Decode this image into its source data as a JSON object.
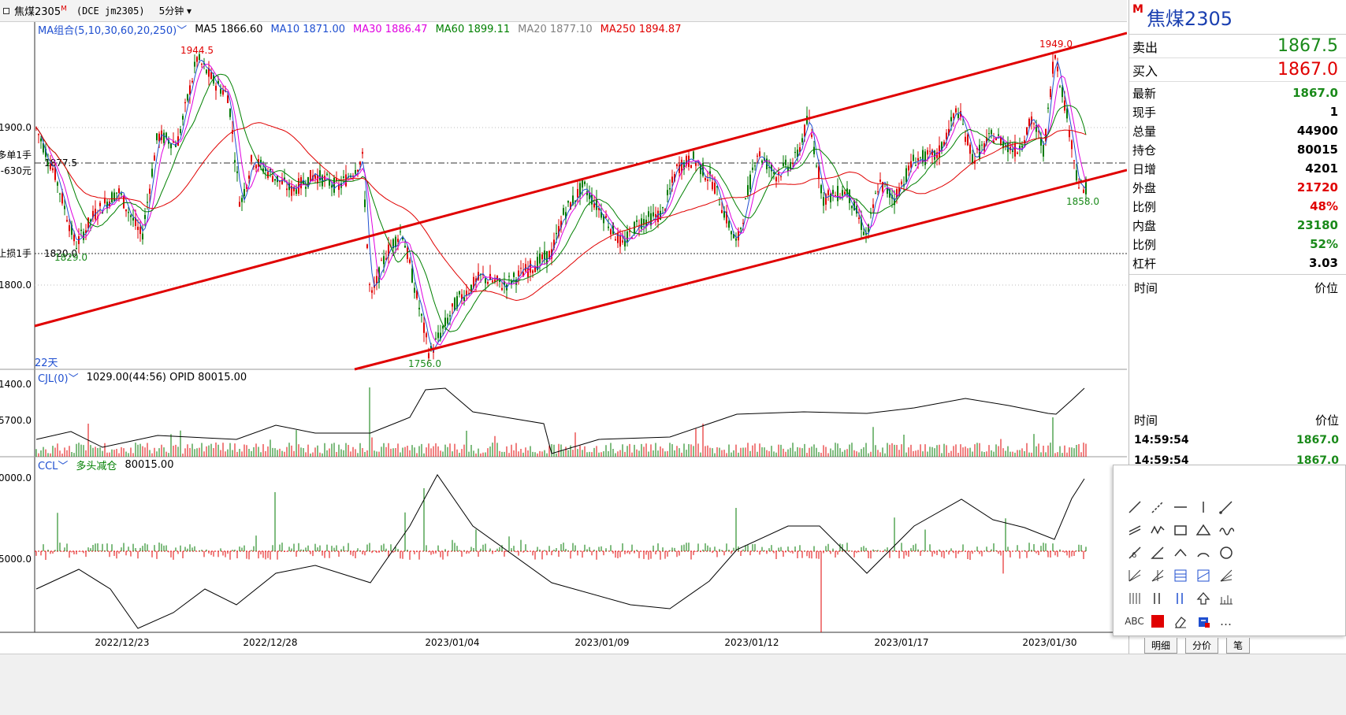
{
  "window": {
    "symbol": "焦煤2305",
    "symbol_marker": "M",
    "code": "(DCE  jm2305)",
    "period": "5分钟"
  },
  "colors": {
    "up": "#e00000",
    "down": "#007a00",
    "ma5": "#000000",
    "ma10": "#1f4fd0",
    "ma30": "#e000e0",
    "ma60": "#008000",
    "ma20": "#808080",
    "ma250": "#e00000",
    "channel": "#e00000",
    "price_down": "#1a8a1a",
    "price_up": "#e00000"
  },
  "indicators": {
    "ma_group": "MA组合(5,10,30,60,20,250)",
    "ma5": "MA5  1866.60",
    "ma10": "MA10  1871.00",
    "ma30": "MA30  1886.47",
    "ma60": "MA60  1899.11",
    "ma20": "MA20  1877.10",
    "ma250": "MA250  1894.87"
  },
  "price_pane": {
    "y_labels": [
      "1900.0",
      "1800.0"
    ],
    "lines": {
      "open_label": "多单1手",
      "open_price": "1877.5",
      "pnl": "-630元",
      "stop_label": "止损1手",
      "stop_price": "1820.0"
    },
    "annotations": {
      "high1": "1944.5",
      "low1": "1829.0",
      "low2": "1756.0",
      "high2": "1949.0",
      "last": "1858.0"
    },
    "days": "22天"
  },
  "vol_pane": {
    "title": "CJL(0)",
    "value": "1029.00(44:56)  OPID 80015.00",
    "y_labels": [
      "1400.0",
      "5700.0"
    ]
  },
  "ccl_pane": {
    "title": "CCL",
    "label": "多头减仓",
    "value": "80015.00",
    "y_labels": [
      "0000.0",
      "5000.0"
    ]
  },
  "x_axis": [
    "2022/12/23",
    "2022/12/28",
    "2023/01/04",
    "2023/01/09",
    "2023/01/12",
    "2023/01/17",
    "2023/01/30"
  ],
  "quote": {
    "sell_label": "卖出",
    "sell_value": "1867.5",
    "buy_label": "买入",
    "buy_value": "1867.0",
    "rows": [
      {
        "label": "最新",
        "value": "1867.0",
        "color": "#1a8a1a"
      },
      {
        "label": "现手",
        "value": "1",
        "color": "#000000"
      },
      {
        "label": "总量",
        "value": "44900",
        "color": "#000000"
      },
      {
        "label": "持仓",
        "value": "80015",
        "color": "#000000"
      },
      {
        "label": "日增",
        "value": "4201",
        "color": "#000000"
      },
      {
        "label": "外盘",
        "value": "21720",
        "color": "#e00000"
      },
      {
        "label": "比例",
        "value": "48%",
        "color": "#e00000"
      },
      {
        "label": "内盘",
        "value": "23180",
        "color": "#1a8a1a"
      },
      {
        "label": "比例",
        "value": "52%",
        "color": "#1a8a1a"
      },
      {
        "label": "杠杆",
        "value": "3.03",
        "color": "#000000"
      }
    ],
    "time_label": "时间",
    "price_label": "价位"
  },
  "ticks": {
    "head_time": "时间",
    "head_price": "价位",
    "rows": [
      {
        "time": "14:59:54",
        "price": "1867.0"
      },
      {
        "time": "14:59:54",
        "price": "1867.0"
      }
    ]
  },
  "draw_tools": {
    "abc_label": "ABC",
    "more_label": "…"
  },
  "bottom_tabs": [
    "明细",
    "分价",
    "笔"
  ]
}
